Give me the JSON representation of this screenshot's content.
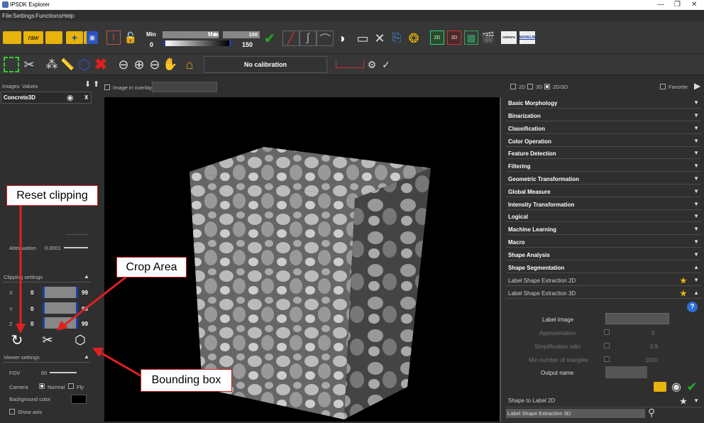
{
  "window": {
    "title": "IPSDK Explorer",
    "minimize": "—",
    "restore": "❐",
    "close": "✕"
  },
  "menu": [
    "File",
    "Settings",
    "Functions",
    "Help"
  ],
  "toolbar": {
    "min_label": "Min",
    "min_value": "0",
    "min_field": "0",
    "max_label": "Max",
    "max_value": "150",
    "max_field": "150",
    "btn_2d": "2D",
    "btn_3d": "3D",
    "logo1": "camera",
    "logo2": "MOHELIN",
    "calibration": "No calibration",
    "colors": {
      "accent": "#e8b30a",
      "ok": "#22aa22",
      "error": "#dd2020",
      "highlight_red": "#cc2222"
    }
  },
  "left": {
    "tab_images": "Images",
    "tab_values": "Values",
    "image_item": "Concrete3D",
    "close_x": "X",
    "attenuation_label": "Attenuation",
    "attenuation_value": "0.0001",
    "clipping_header": "Clipping settings",
    "clip_rows": [
      {
        "axis": "X",
        "min": "0",
        "max": "99"
      },
      {
        "axis": "Y",
        "min": "0",
        "max": "99"
      },
      {
        "axis": "Z",
        "min": "0",
        "max": "99"
      }
    ],
    "viewer_header": "Viewer settings",
    "fov_label": "FOV",
    "fov_value": "60",
    "camera_label": "Camera",
    "camera_normal": "Normal",
    "camera_fly": "Fly",
    "bg_label": "Background color",
    "show_axis": "Show axis"
  },
  "viewer": {
    "overlay_label": "Image in overlay"
  },
  "right": {
    "opt_2d": "2D",
    "opt_3d": "3D",
    "opt_2d3d": "2D/3D",
    "favorite": "Favorite",
    "categories": [
      "Basic Morphology",
      "Binarization",
      "Classification",
      "Color Operation",
      "Feature Detection",
      "Filtering",
      "Geometric Transformation",
      "Global Measure",
      "Intensity Transformation",
      "Logical",
      "Machine Learning",
      "Macro",
      "Shape Analysis",
      "Shape Segmentation"
    ],
    "sub_items": [
      "Label Shape Extraction 2D",
      "Label Shape Extraction 3D"
    ],
    "params": [
      {
        "label": "Label Image",
        "value": ""
      },
      {
        "label": "Approximation",
        "value": "0"
      },
      {
        "label": "Simplification ratio",
        "value": "0.9"
      },
      {
        "label": "Min number of triangles",
        "value": "1000"
      },
      {
        "label": "Output name",
        "value": ""
      }
    ],
    "next_item": "Shape to Label 2D",
    "search_value": "Label Shape Extraction 3D",
    "help": "?"
  },
  "callouts": {
    "reset": "Reset clipping",
    "crop": "Crop Area",
    "bbox": "Bounding box"
  }
}
